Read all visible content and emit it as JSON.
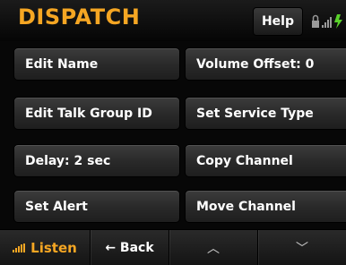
{
  "header": {
    "title": "DISPATCH",
    "help_label": "Help"
  },
  "buttons": {
    "edit_name": "Edit Name",
    "volume_offset": "Volume Offset: 0",
    "edit_talk_group_id": "Edit Talk Group ID",
    "set_service_type": "Set Service Type",
    "delay": "Delay: 2 sec",
    "copy_channel": "Copy Channel",
    "set_alert": "Set Alert",
    "move_channel": "Move Channel"
  },
  "footer": {
    "listen_label": "Listen",
    "back_label": "← Back",
    "up_glyph": "︿",
    "down_glyph": "﹀"
  },
  "colors": {
    "accent": "#f5a623",
    "battery": "#59d12a"
  },
  "icons": [
    "lock-icon",
    "signal-icon",
    "battery-icon",
    "signal-bars-icon",
    "chevron-up-icon",
    "chevron-down-icon"
  ]
}
